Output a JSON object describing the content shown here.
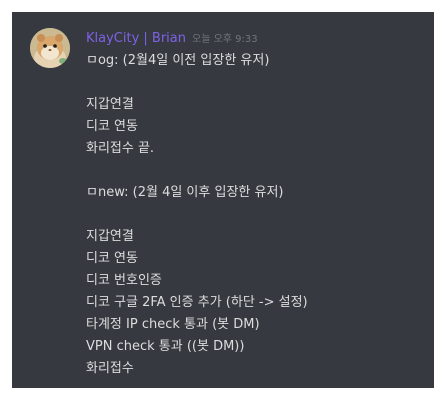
{
  "message": {
    "username": "KlayCity | Brian",
    "timestamp": "오늘 오후 9:33",
    "lines": [
      "ㅁog: (2월4일 이전 입장한 유저)",
      "",
      "지갑연결",
      "디코 연동",
      "화리접수 끝.",
      "",
      "ㅁnew: (2월 4일 이후 입장한 유저)",
      "",
      "지갑연결",
      "디코 연동",
      "디코  번호인증",
      "디코 구글 2FA 인증 추가 (하단 -> 설정)",
      "타계정 IP check 통과 (봇 DM)",
      "VPN check 통과 ((봇 DM))",
      "화리접수"
    ]
  },
  "colors": {
    "panel_bg": "#36393f",
    "username": "#7d62e6",
    "timestamp": "#72767d",
    "text": "#dcddde"
  },
  "icons": {
    "avatar": "hamster-avatar"
  }
}
